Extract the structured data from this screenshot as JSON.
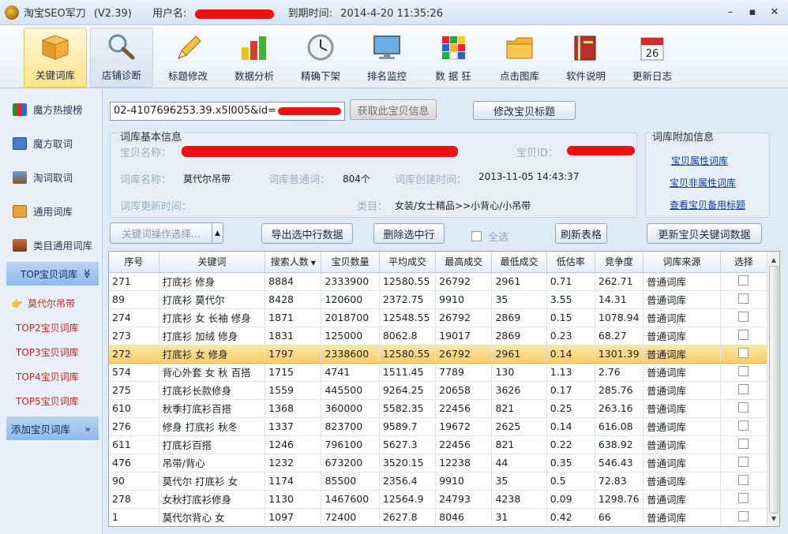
{
  "window": {
    "app_name": "淘宝SEO军刀",
    "version": "(V2.39)",
    "user_label": "用户名:",
    "expiry_label": "到期时间:",
    "expiry_value": "2014-4-20 11:35:26",
    "controls": {
      "min": "–",
      "max": "▪",
      "close": "✕"
    }
  },
  "toolbar": {
    "items": [
      {
        "label": "关键词库",
        "icon": "box-icon"
      },
      {
        "label": "店铺诊断",
        "icon": "magnifier-icon"
      },
      {
        "label": "标题修改",
        "icon": "pencil-icon"
      },
      {
        "label": "数据分析",
        "icon": "bar-chart-icon"
      },
      {
        "label": "精确下架",
        "icon": "clock-icon"
      },
      {
        "label": "排名监控",
        "icon": "monitor-icon"
      },
      {
        "label": "数 据 狂",
        "icon": "rubik-cube-icon"
      },
      {
        "label": "点击图库",
        "icon": "folder-icon"
      },
      {
        "label": "软件说明",
        "icon": "book-icon"
      },
      {
        "label": "更新日志",
        "icon": "calendar-icon"
      }
    ]
  },
  "sidebar": {
    "items": [
      {
        "label": "魔方热搜榜"
      },
      {
        "label": "魔方取词"
      },
      {
        "label": "淘词取词"
      },
      {
        "label": "通用词库"
      },
      {
        "label": "类目通用词库"
      }
    ],
    "group": {
      "label": "TOP宝贝词库",
      "chevron": "≫"
    },
    "subitems": [
      "莫代尔吊带",
      "TOP2宝贝词库",
      "TOP3宝贝词库",
      "TOP4宝贝词库",
      "TOP5宝贝词库"
    ],
    "add": {
      "label": "添加宝贝词库",
      "chevron": "»"
    }
  },
  "main": {
    "url_value": "02-4107696253.39.x5l005&id=",
    "fetch_button": "获取此宝贝信息",
    "edit_title_button": "修改宝贝标题",
    "info": {
      "legend": "词库基本信息",
      "item_name_label": "宝贝名称：",
      "item_id_label": "宝贝ID：",
      "lib_name_label": "词库名称：",
      "lib_name_value": "莫代尔吊带",
      "normal_words_label": "词库普通词：",
      "normal_words_value": "804个",
      "created_label": "词库创建时间：",
      "created_value": "2013-11-05 14:43:37",
      "updated_label": "词库更新时间：",
      "category_label": "类目：",
      "category_value": "女装/女士精品>>小背心/小吊带"
    },
    "extra": {
      "legend": "词库附加信息",
      "links": [
        "宝贝属性词库",
        "宝贝非属性词库",
        "查看宝贝备用标题"
      ]
    },
    "actions": {
      "keyword_ops": "关键词操作选择...",
      "export": "导出选中行数据",
      "delete": "删除选中行",
      "select_all": "全选",
      "refresh": "刷新表格",
      "update": "更新宝贝关键词数据"
    },
    "table": {
      "headers": [
        "序号",
        "关键词",
        "搜索人数",
        "宝贝数量",
        "平均成交",
        "最高成交",
        "最低成交",
        "低估率",
        "竞争度",
        "词库来源",
        "选择"
      ],
      "sort_indicator": "▼",
      "rows": [
        [
          "271",
          "打底衫 修身",
          "8884",
          "2333900",
          "12580.55",
          "26792",
          "2961",
          "0.71",
          "262.71",
          "普通词库"
        ],
        [
          "89",
          "打底衫 莫代尔",
          "8428",
          "120600",
          "2372.75",
          "9910",
          "35",
          "3.55",
          "14.31",
          "普通词库"
        ],
        [
          "274",
          "打底衫 女 长袖 修身",
          "1871",
          "2018700",
          "12548.55",
          "26792",
          "2869",
          "0.15",
          "1078.94",
          "普通词库"
        ],
        [
          "273",
          "打底衫  加绒  修身",
          "1831",
          "125000",
          "8062.8",
          "19017",
          "2869",
          "0.23",
          "68.27",
          "普通词库"
        ],
        [
          "272",
          "打底衫 女 修身",
          "1797",
          "2338600",
          "12580.55",
          "26792",
          "2961",
          "0.14",
          "1301.39",
          "普通词库"
        ],
        [
          "574",
          "背心外套 女 秋 百搭",
          "1715",
          "4741",
          "1511.45",
          "7789",
          "130",
          "1.13",
          "2.76",
          "普通词库"
        ],
        [
          "275",
          "打底衫长款修身",
          "1559",
          "445500",
          "9264.25",
          "20658",
          "3626",
          "0.17",
          "285.76",
          "普通词库"
        ],
        [
          "610",
          "秋季打底衫百搭",
          "1368",
          "360000",
          "5582.35",
          "22456",
          "821",
          "0.25",
          "263.16",
          "普通词库"
        ],
        [
          "276",
          "修身 打底衫 秋冬",
          "1337",
          "823700",
          "9589.7",
          "19672",
          "2625",
          "0.14",
          "616.08",
          "普通词库"
        ],
        [
          "611",
          "打底衫百搭",
          "1246",
          "796100",
          "5627.3",
          "22456",
          "821",
          "0.22",
          "638.92",
          "普通词库"
        ],
        [
          "476",
          "吊带/背心",
          "1232",
          "673200",
          "3520.15",
          "12238",
          "44",
          "0.35",
          "546.43",
          "普通词库"
        ],
        [
          "90",
          "莫代尔 打底衫 女",
          "1174",
          "85500",
          "2356.4",
          "9910",
          "35",
          "0.5",
          "72.83",
          "普通词库"
        ],
        [
          "278",
          "女秋打底衫修身",
          "1130",
          "1467600",
          "12564.9",
          "24793",
          "4238",
          "0.09",
          "1298.76",
          "普通词库"
        ],
        [
          "1",
          "莫代尔背心 女",
          "1097",
          "72400",
          "2627.8",
          "8046",
          "31",
          "0.42",
          "66",
          "普通词库"
        ]
      ]
    }
  }
}
